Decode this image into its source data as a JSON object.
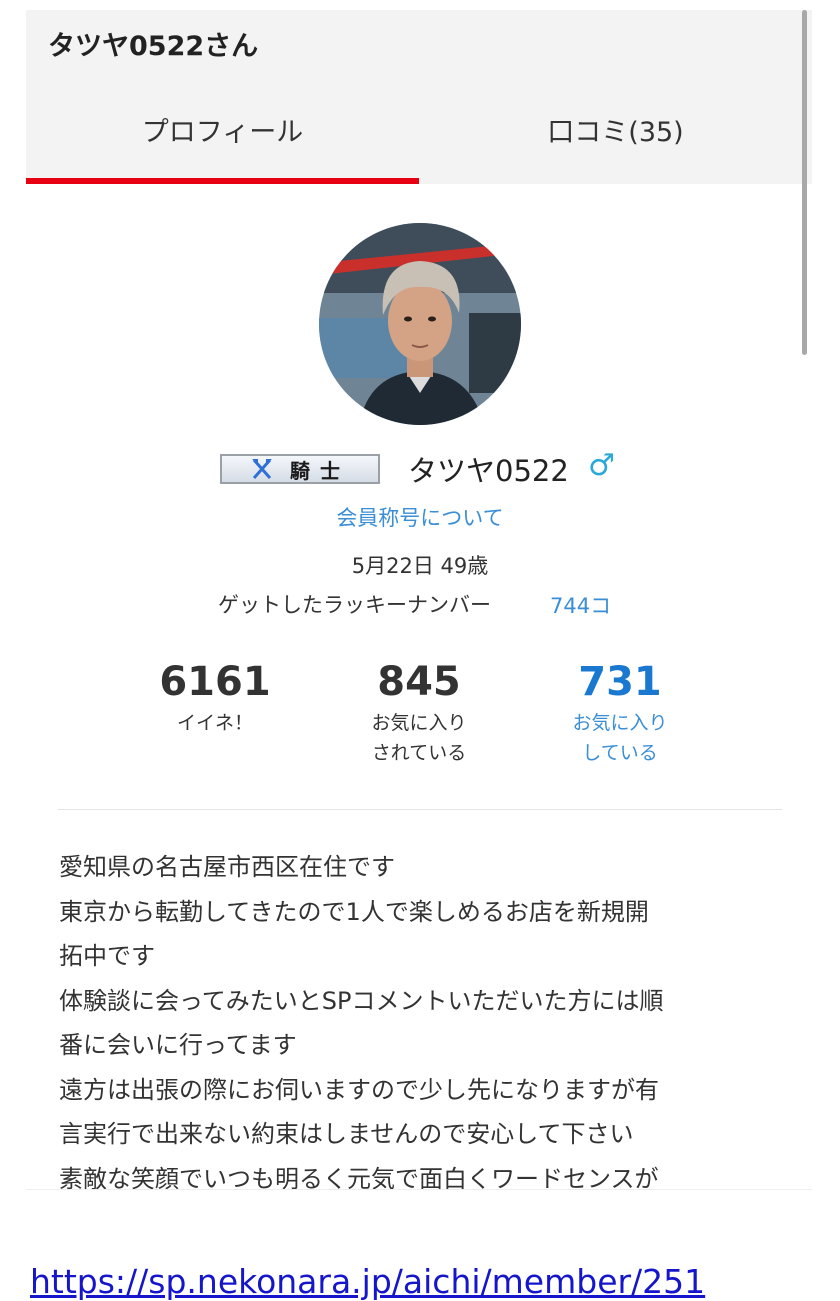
{
  "header": {
    "title": "タツヤ0522さん"
  },
  "tabs": [
    {
      "label": "プロフィール",
      "active": true
    },
    {
      "label": "口コミ(35)",
      "active": false
    }
  ],
  "profile": {
    "avatar": "avatar-photo",
    "rank_badge": "騎士",
    "name": "タツヤ0522",
    "gender_icon": "♂",
    "title_link": "会員称号について",
    "birthday_age": "5月22日 49歳",
    "lucky_label": "ゲットしたラッキーナンバー",
    "lucky_value": "744コ"
  },
  "stats": [
    {
      "value": "6161",
      "label_line1": "イイネ！",
      "label_line2": ""
    },
    {
      "value": "845",
      "label_line1": "お気に入り",
      "label_line2": "されている"
    },
    {
      "value": "731",
      "label_line1": "お気に入り",
      "label_line2": "している"
    }
  ],
  "bio_lines": [
    "愛知県の名古屋市西区在住です",
    "東京から転勤してきたので1人で楽しめるお店を新規開",
    "拓中です",
    "体験談に会ってみたいとSPコメントいただいた方には順",
    "番に会いに行ってます",
    "遠方は出張の際にお伺いますので少し先になりますが有",
    "言実行で出来ない約束はしませんので安心して下さい",
    "素敵な笑顔でいつも明るく元気で面白くワードセンスが"
  ],
  "url_text": "https://sp.nekonara.jp/aichi/member/251",
  "colors": {
    "accent_red": "#e60012",
    "link_blue": "#3a8ed6",
    "stat_blue": "#1b78d0",
    "gender_blue": "#2aa9d8"
  }
}
